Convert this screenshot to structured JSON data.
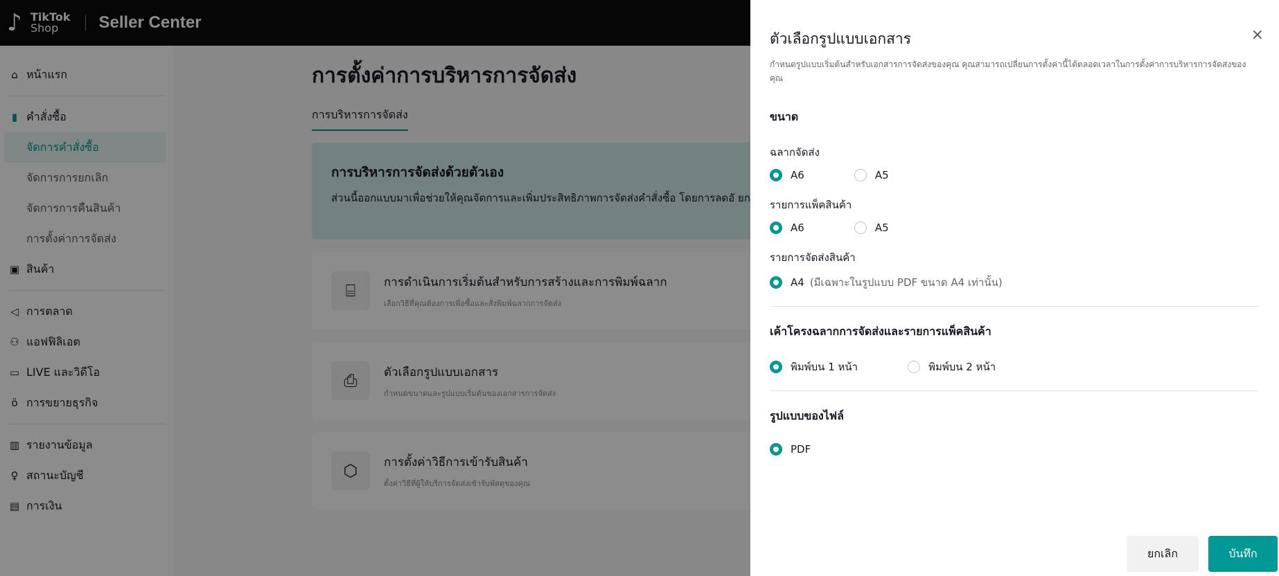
{
  "brand": {
    "logo_line1": "TikTok",
    "logo_line2": "Shop",
    "app_name": "Seller Center"
  },
  "sidebar": {
    "home": "หน้าแรก",
    "orders": "คำสั่งซื้อ",
    "orders_sub": [
      "จัดการคำสั่งซื้อ",
      "จัดการการยกเลิก",
      "จัดการการคืนสินค้า",
      "การตั้งค่าการจัดส่ง"
    ],
    "products": "สินค้า",
    "marketing": "การตลาด",
    "affiliate": "แอฟฟิลิเอต",
    "live": "LIVE และวิดีโอ",
    "growth": "การขยายธุรกิจ",
    "reports": "รายงานข้อมูล",
    "account": "สถานะบัญชี",
    "finance": "การเงิน"
  },
  "main": {
    "title": "การตั้งค่าการบริหารการจัดส่ง",
    "tab": "การบริหารการจัดส่ง",
    "banner_title": "การบริหารการจัดส่งด้วยตัวเอง",
    "banner_text": "ส่วนนี้ออกแบบมาเพื่อช่วยให้คุณจัดการและเพิ่มประสิทธิภาพการจัดส่งคำสั่งซื้อ โดยการลดอั ยกเลิกจากข้อผิดพลาดของผู้ขาย (SFCR)",
    "cards": [
      {
        "title": "การดำเนินการเริ่มต้นสำหรับการสร้างและการพิมพ์ฉลาก",
        "sub": "เลือกวิธีที่คุณต้องการเพื่อซื้อและสั่งพิมพ์ฉลากการจัดส่ง"
      },
      {
        "title": "ตัวเลือกรูปแบบเอกสาร",
        "sub": "กำหนดขนาดและรูปแบบเริ่มต้นของเอกสารการจัดส่ง"
      },
      {
        "title": "การตั้งค่าวิธีการเข้ารับสินค้า",
        "sub": "ตั้งค่าวิธีที่ผู้ให้บริการจัดส่งเข้ารับพัสดุของคุณ"
      }
    ]
  },
  "drawer": {
    "title": "ตัวเลือกรูปแบบเอกสาร",
    "close": "×",
    "desc": "กำหนดรูปแบบเริ่มต้นสำหรับเอกสารการจัดส่งของคุณ คุณสามารถเปลี่ยนการตั้งค่านี้ได้ตลอดเวลาในการตั้งค่าการบริหารการจัดส่งของคุณ",
    "size_title": "ขนาด",
    "shipping_label": {
      "label": "ฉลากจัดส่ง",
      "opt1": "A6",
      "opt2": "A5",
      "selected": "A6"
    },
    "packing_list": {
      "label": "รายการแพ็คสินค้า",
      "opt1": "A6",
      "opt2": "A5",
      "selected": "A6"
    },
    "pick_list": {
      "label": "รายการจัดส่งสินค้า",
      "opt1": "A4",
      "note": "(มีเฉพาะในรูปแบบ PDF ขนาด A4 เท่านั้น)",
      "selected": "A4"
    },
    "layout_title": "เค้าโครงฉลากการจัดส่งและรายการแพ็คสินค้า",
    "layout_opt1": "พิมพ์บน 1 หน้า",
    "layout_opt2": "พิมพ์บน 2 หน้า",
    "format_title": "รูปแบบของไฟล์",
    "format_opt1": "PDF",
    "cancel": "ยกเลิก",
    "save": "บันทึก"
  },
  "colors": {
    "accent": "#009995",
    "topbar": "#0c0c0e"
  }
}
